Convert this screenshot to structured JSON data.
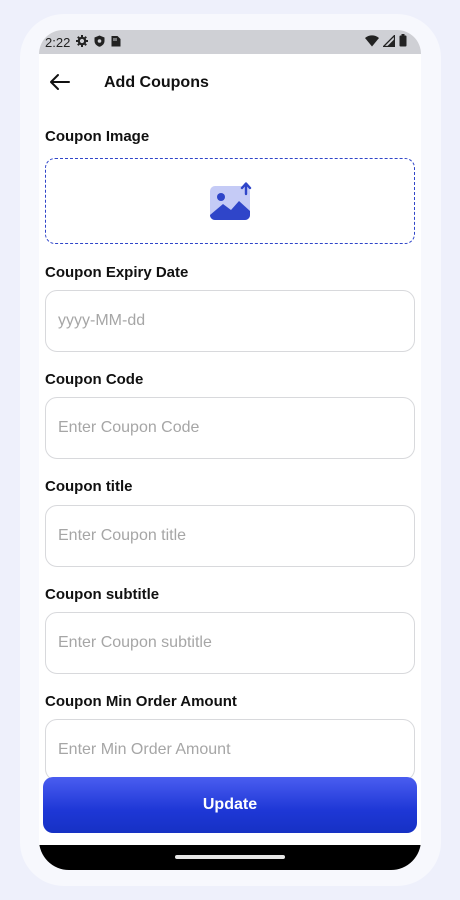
{
  "status_bar": {
    "time": "2:22",
    "icons": [
      "settings-icon",
      "shield-icon",
      "sim-card-icon",
      "wifi-icon",
      "signal-icon",
      "battery-icon"
    ]
  },
  "app_bar": {
    "back_icon": "arrow-left-icon",
    "title": "Add Coupons"
  },
  "form": {
    "image": {
      "label": "Coupon Image",
      "icon": "image-upload-icon"
    },
    "expiry": {
      "label": "Coupon Expiry Date",
      "placeholder": "yyyy-MM-dd",
      "value": ""
    },
    "code": {
      "label": "Coupon Code",
      "placeholder": "Enter Coupon Code",
      "value": ""
    },
    "title": {
      "label": "Coupon title",
      "placeholder": "Enter Coupon title",
      "value": ""
    },
    "subtitle": {
      "label": "Coupon subtitle",
      "placeholder": "Enter Coupon subtitle",
      "value": ""
    },
    "min_order": {
      "label": "Coupon Min Order Amount",
      "placeholder": "Enter Min Order Amount",
      "value": ""
    }
  },
  "actions": {
    "update_label": "Update"
  },
  "colors": {
    "accent": "#1e37d6",
    "dashed_border": "#2f45c9",
    "background": "#eef0fb"
  }
}
